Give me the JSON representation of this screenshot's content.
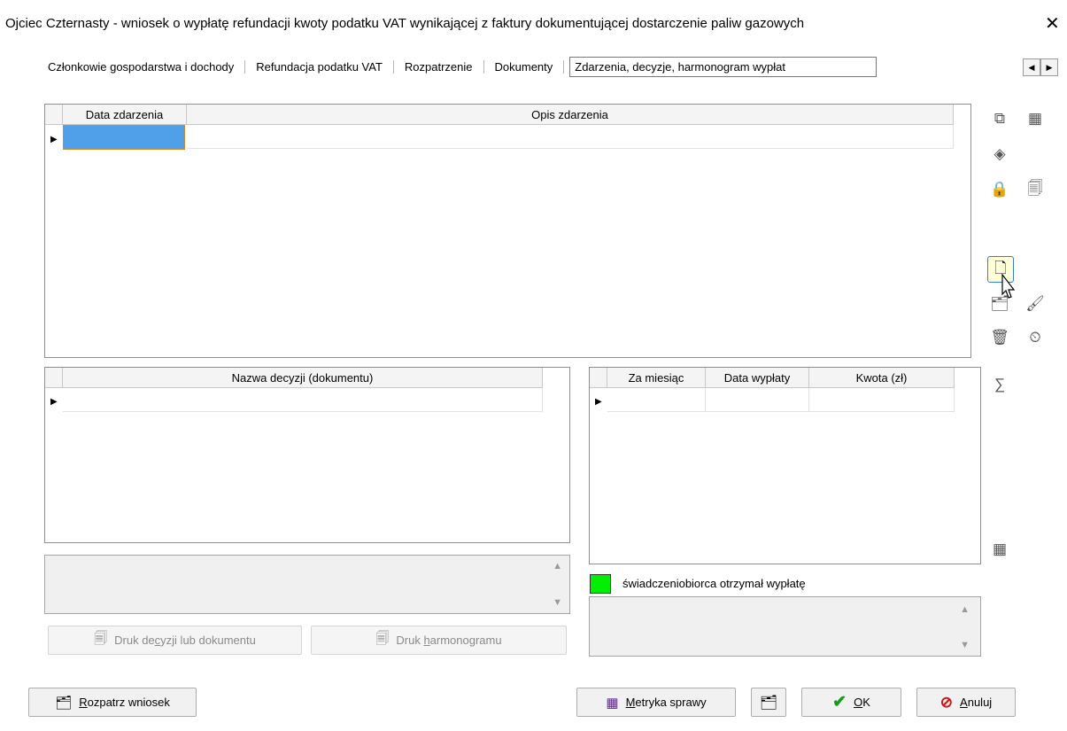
{
  "window": {
    "title": "Ojciec Czternasty - wniosek o wypłatę refundacji kwoty podatku VAT wynikającej z faktury dokumentującej dostarczenie paliw gazowych",
    "close_glyph": "✕"
  },
  "tabs": [
    {
      "label": "Członkowie gospodarstwa i dochody"
    },
    {
      "label": "Refundacja podatku VAT"
    },
    {
      "label": "Rozpatrzenie"
    },
    {
      "label": "Dokumenty"
    },
    {
      "label": "Zdarzenia, decyzje, harmonogram wypłat"
    }
  ],
  "tab_arrows": {
    "left": "◀",
    "right": "▶"
  },
  "events_grid": {
    "columns": [
      "Data zdarzenia",
      "Opis zdarzenia"
    ],
    "selected_color": "#4f9fe9"
  },
  "decisions_grid": {
    "columns": [
      "Nazwa decyzji (dokumentu)"
    ]
  },
  "schedule_grid": {
    "columns": [
      "Za miesiąc",
      "Data wypłaty",
      "Kwota (zł)"
    ]
  },
  "legend": {
    "color": "#00ee00",
    "text": "świadczeniobiorca otrzymał wypłatę"
  },
  "icons": {
    "event_add": "⧉",
    "event_edit": "◈",
    "lock": "🔒",
    "doc_print": "🗐",
    "new_doc": "🗋",
    "copy": "🗂",
    "brush": "🖌",
    "trash": "🗑",
    "clock": "⏲",
    "sum": "∑",
    "table": "▦"
  },
  "buttons": {
    "print_decision": {
      "pre": "Druk de",
      "acc": "c",
      "post": "yzji lub dokumentu"
    },
    "print_schedule": {
      "pre": "Druk ",
      "acc": "h",
      "post": "armonogramu"
    },
    "review": {
      "acc": "R",
      "post": "ozpatrz wniosek"
    },
    "metrics": {
      "acc": "M",
      "post": "etryka sprawy"
    },
    "ok": {
      "acc": "O",
      "post": "K"
    },
    "cancel": {
      "acc": "A",
      "post": "nuluj"
    }
  },
  "colors": {
    "ok_check": "#1a9a1a",
    "cancel_icon": "#d01414"
  }
}
